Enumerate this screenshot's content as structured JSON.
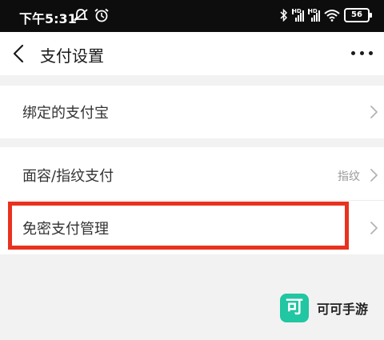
{
  "status_bar": {
    "time": "下午5:31",
    "battery": "56",
    "icons": [
      "mute-icon",
      "alarm-icon",
      "bluetooth-icon",
      "signal-hd-icon",
      "signal-hd-icon",
      "wifi-icon",
      "battery-icon"
    ]
  },
  "nav": {
    "title": "支付设置",
    "back_icon": "chevron-left-icon",
    "more_icon": "more-horizontal-icon"
  },
  "settings": {
    "rows": [
      {
        "label": "绑定的支付宝",
        "value": ""
      },
      {
        "label": "面容/指纹支付",
        "value": "指纹"
      },
      {
        "label": "免密支付管理",
        "value": ""
      }
    ]
  },
  "highlight_color": "#e8321f",
  "watermark": {
    "logo_char": "可",
    "text": "可可手游",
    "color": "#21c6a2"
  }
}
